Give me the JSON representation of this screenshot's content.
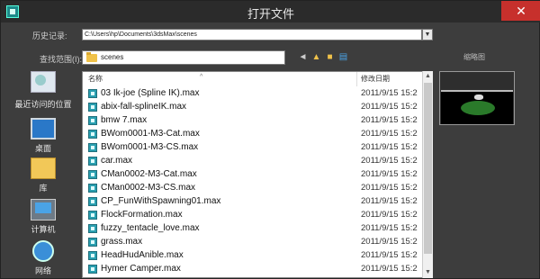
{
  "window": {
    "title": "打开文件",
    "close_glyph": "✕"
  },
  "history": {
    "label": "历史记录:",
    "value": "C:\\Users\\hp\\Documents\\3dsMax\\scenes"
  },
  "lookin": {
    "label": "查找范围(I):",
    "value": "scenes"
  },
  "thumbnail": {
    "label": "缩略图"
  },
  "toolbar": [
    "back-icon",
    "up-folder-icon",
    "new-folder-icon",
    "view-menu-icon"
  ],
  "places": [
    {
      "label": "最近访问的位置",
      "icon": "recent-places-icon"
    },
    {
      "label": "桌面",
      "icon": "desktop-icon"
    },
    {
      "label": "库",
      "icon": "library-icon"
    },
    {
      "label": "计算机",
      "icon": "computer-icon"
    },
    {
      "label": "网络",
      "icon": "network-icon"
    }
  ],
  "columns": {
    "name": "名称",
    "date": "修改日期"
  },
  "files": [
    {
      "name": "03 Ik-joe (Spline IK).max",
      "date": "2011/9/15 15:2"
    },
    {
      "name": "abix-fall-splineIK.max",
      "date": "2011/9/15 15:2"
    },
    {
      "name": "bmw 7.max",
      "date": "2011/9/15 15:2"
    },
    {
      "name": "BWom0001-M3-Cat.max",
      "date": "2011/9/15 15:2"
    },
    {
      "name": "BWom0001-M3-CS.max",
      "date": "2011/9/15 15:2"
    },
    {
      "name": "car.max",
      "date": "2011/9/15 15:2"
    },
    {
      "name": "CMan0002-M3-Cat.max",
      "date": "2011/9/15 15:2"
    },
    {
      "name": "CMan0002-M3-CS.max",
      "date": "2011/9/15 15:2"
    },
    {
      "name": "CP_FunWithSpawning01.max",
      "date": "2011/9/15 15:2"
    },
    {
      "name": "FlockFormation.max",
      "date": "2011/9/15 15:2"
    },
    {
      "name": "fuzzy_tentacle_love.max",
      "date": "2011/9/15 15:2"
    },
    {
      "name": "grass.max",
      "date": "2011/9/15 15:2"
    },
    {
      "name": "HeadHudAnible.max",
      "date": "2011/9/15 15:2"
    },
    {
      "name": "Hymer Camper.max",
      "date": "2011/9/15 15:2"
    }
  ],
  "colors": {
    "window_bg": "#3d3d3d",
    "titlebar": "#2b2b2b",
    "close": "#c7302c",
    "file_icon": "#2a9fb0"
  }
}
